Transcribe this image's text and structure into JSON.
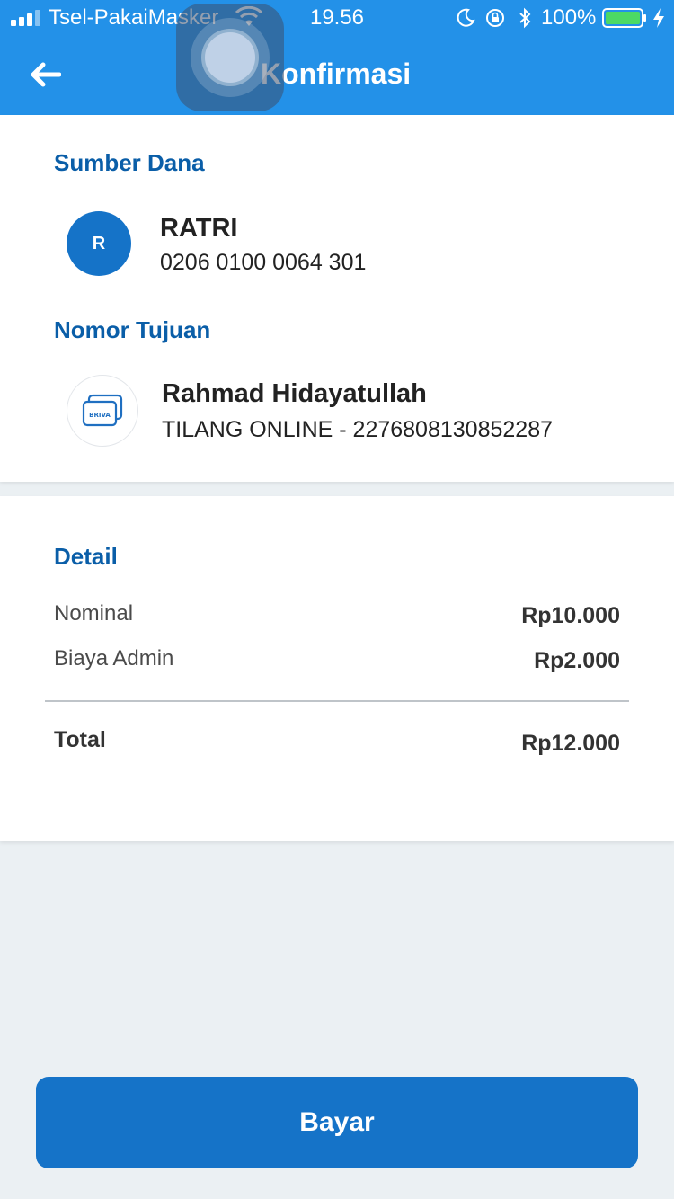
{
  "status_bar": {
    "carrier": "Tsel-PakaiMasker",
    "time": "19.56",
    "battery": "100%"
  },
  "header": {
    "title": "Konfirmasi",
    "back_icon": "arrow-left-icon",
    "color": "#2391e8"
  },
  "source": {
    "section_title": "Sumber Dana",
    "avatar_initial": "R",
    "name": "RATRI",
    "account": "0206 0100 0064 301"
  },
  "destination": {
    "section_title": "Nomor Tujuan",
    "icon_label": "BRIVA",
    "name": "Rahmad Hidayatullah",
    "detail": "TILANG ONLINE - 2276808130852287"
  },
  "detail": {
    "section_title": "Detail",
    "rows": [
      {
        "label": "Nominal",
        "value": "Rp10.000"
      },
      {
        "label": "Biaya Admin",
        "value": "Rp2.000"
      }
    ],
    "total_label": "Total",
    "total_value": "Rp12.000"
  },
  "pay_button": {
    "label": "Bayar",
    "color": "#1573c8"
  }
}
